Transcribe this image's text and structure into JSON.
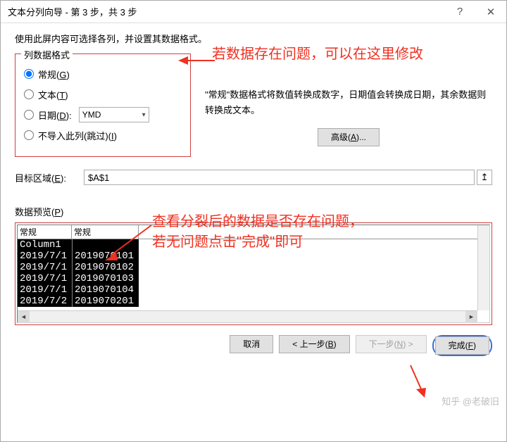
{
  "titlebar": {
    "title": "文本分列向导 - 第 3 步，共 3 步"
  },
  "instruction": "使用此屏内容可选择各列，并设置其数据格式。",
  "format_group": {
    "legend": "列数据格式",
    "general": "常规(G)",
    "text": "文本(T)",
    "date": "日期(D):",
    "date_value": "YMD",
    "skip": "不导入此列(跳过)(I)"
  },
  "description": "\"常规\"数据格式将数值转换成数字，日期值会转换成日期，其余数据则转换成文本。",
  "advanced_btn": "高级(A)...",
  "target": {
    "label": "目标区域(E):",
    "value": "$A$1"
  },
  "preview": {
    "label": "数据预览(P)",
    "headers": [
      "常规",
      "常规"
    ],
    "rows": [
      [
        "Column1",
        ""
      ],
      [
        "2019/7/1",
        "2019070101"
      ],
      [
        "2019/7/1",
        "2019070102"
      ],
      [
        "2019/7/1",
        "2019070103"
      ],
      [
        "2019/7/1",
        "2019070104"
      ],
      [
        "2019/7/2",
        "2019070201"
      ]
    ]
  },
  "buttons": {
    "cancel": "取消",
    "back": "< 上一步(B)",
    "next": "下一步(N) >",
    "finish": "完成(F)"
  },
  "annotations": {
    "top": "若数据存在问题，可以在这里修改",
    "mid1": "查看分裂后的数据是否存在问题，",
    "mid2": "若无问题点击\"完成\"即可"
  },
  "watermark": "知乎 @老破旧"
}
